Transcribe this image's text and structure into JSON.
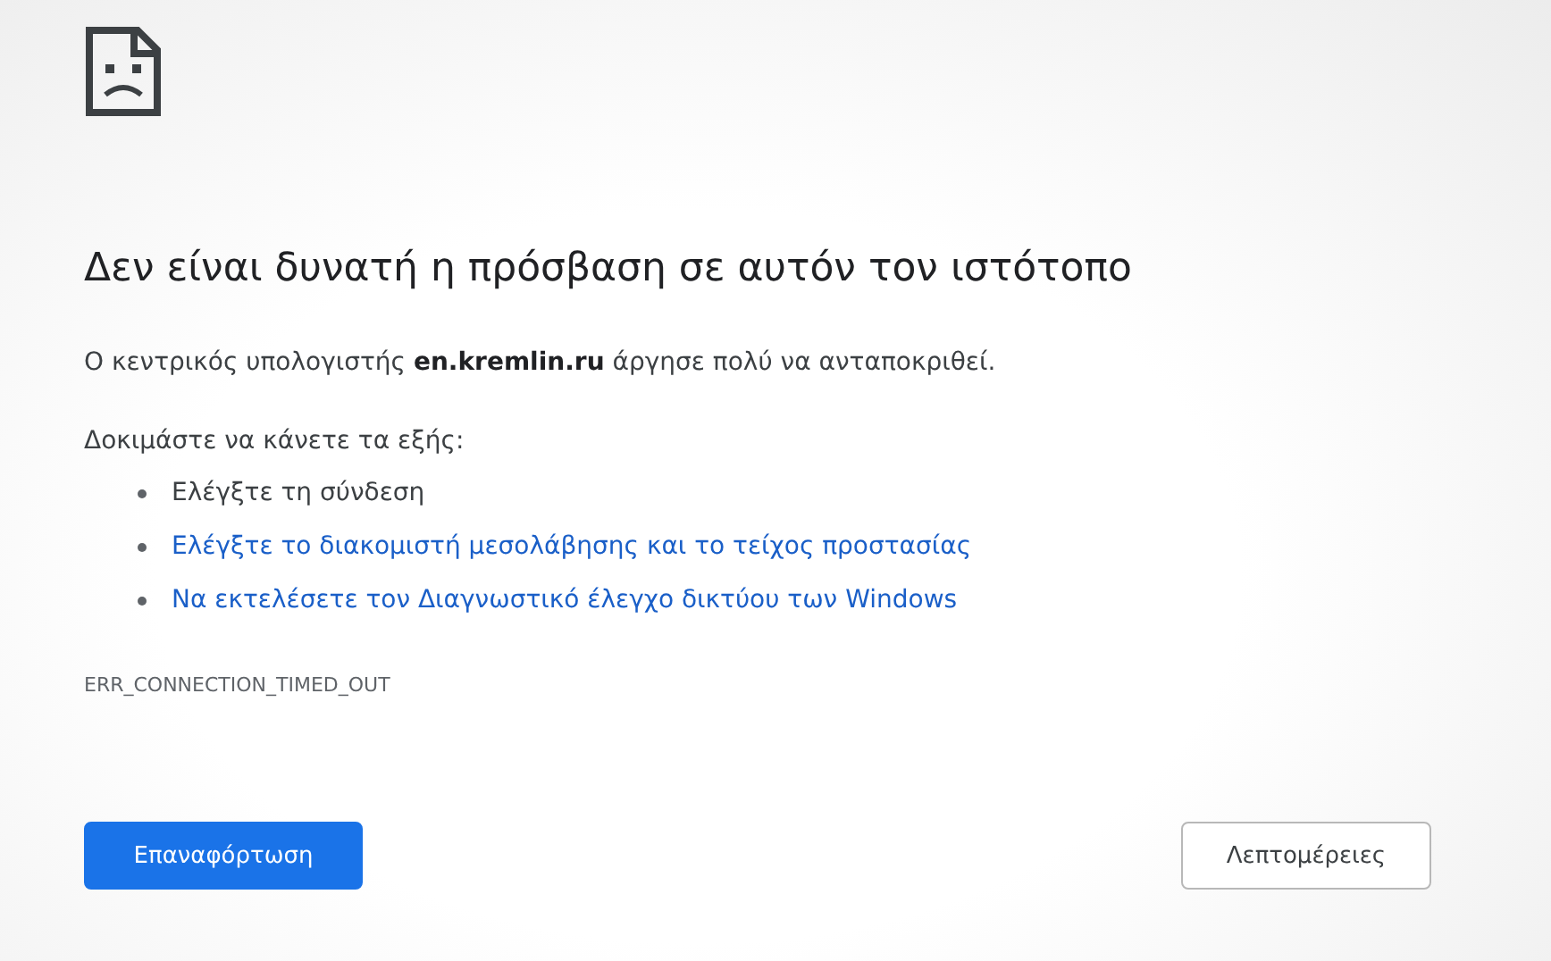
{
  "heading": "Δεν είναι δυνατή η πρόσβαση σε αυτόν τον ιστότοπο",
  "message": "Ο κεντρικός υπολογιστής **en.kremlin.ru** άργησε πολύ να ανταποκριθεί.",
  "suggestions_intro": "Δοκιμάστε να κάνετε τα εξής:",
  "suggestions": [
    {
      "text": "Ελέγξτε τη σύνδεση",
      "kind": "text"
    },
    {
      "text": "Ελέγξτε το διακομιστή μεσολάβησης και το τείχος προστασίας",
      "kind": "link"
    },
    {
      "text": "Να εκτελέσετε τον Διαγνωστικό έλεγχο δικτύου των Windows",
      "kind": "link"
    }
  ],
  "error_code": "ERR_CONNECTION_TIMED_OUT",
  "buttons": [
    {
      "label": "Επαναφόρτωση",
      "kind": "primary"
    },
    {
      "label": "Λεπτομέρειες",
      "kind": "secondary"
    }
  ]
}
